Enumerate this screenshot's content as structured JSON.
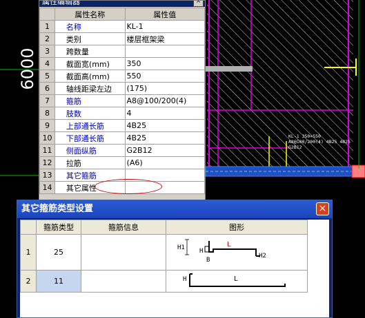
{
  "cad": {
    "dimension_label": "6000",
    "beam_annotation_line1": "KL-1 350×550",
    "beam_annotation_line2": "A8@100/200(4) 4B25 4B25",
    "beam_annotation_line3": "G2B12"
  },
  "props_panel": {
    "title": "属性编辑器",
    "close_label": "×",
    "columns": [
      "",
      "属性名称",
      "属性值"
    ],
    "rows": [
      {
        "num": "1",
        "name": "名称",
        "value": "KL-1",
        "color": "blue"
      },
      {
        "num": "2",
        "name": "类别",
        "value": "楼层框架梁",
        "color": "black"
      },
      {
        "num": "3",
        "name": "跨数量",
        "value": "",
        "color": "black"
      },
      {
        "num": "4",
        "name": "截面宽(mm)",
        "value": "350",
        "color": "black"
      },
      {
        "num": "5",
        "name": "截面高(mm)",
        "value": "550",
        "color": "black"
      },
      {
        "num": "6",
        "name": "轴线距梁左边",
        "value": "(175)",
        "color": "black"
      },
      {
        "num": "7",
        "name": "箍筋",
        "value": "A8@100/200(4)",
        "color": "blue"
      },
      {
        "num": "8",
        "name": "肢数",
        "value": "4",
        "color": "blue"
      },
      {
        "num": "9",
        "name": "上部通长筋",
        "value": "4B25",
        "color": "blue"
      },
      {
        "num": "10",
        "name": "下部通长筋",
        "value": "4B25",
        "color": "blue"
      },
      {
        "num": "11",
        "name": "侧面纵筋",
        "value": "G2B12",
        "color": "blue"
      },
      {
        "num": "12",
        "name": "拉筋",
        "value": "(A6)",
        "color": "black"
      },
      {
        "num": "13",
        "name": "其它箍筋",
        "value": "",
        "color": "blue"
      },
      {
        "num": "14",
        "name": "其它属性",
        "value": "",
        "color": "black"
      }
    ]
  },
  "dialog": {
    "title": "其它箍筋类型设置",
    "close_label": "×",
    "columns": [
      "",
      "箍筋类型",
      "箍筋信息",
      "图形"
    ],
    "rows": [
      {
        "num": "1",
        "type": "25",
        "info": ""
      },
      {
        "num": "2",
        "type": "11",
        "info": ""
      }
    ],
    "shape1_labels": {
      "h1": "H1",
      "h": "H",
      "b": "B",
      "l": "L",
      "h2": "H2"
    },
    "shape2_labels": {
      "h": "H",
      "l": "L"
    }
  },
  "colors": {
    "cad_background": "#000000",
    "title_bar": "#2a5bd7",
    "close_button": "#d8411e",
    "highlight_oval": "#d00000",
    "selected_cell": "#c5d6ee"
  }
}
